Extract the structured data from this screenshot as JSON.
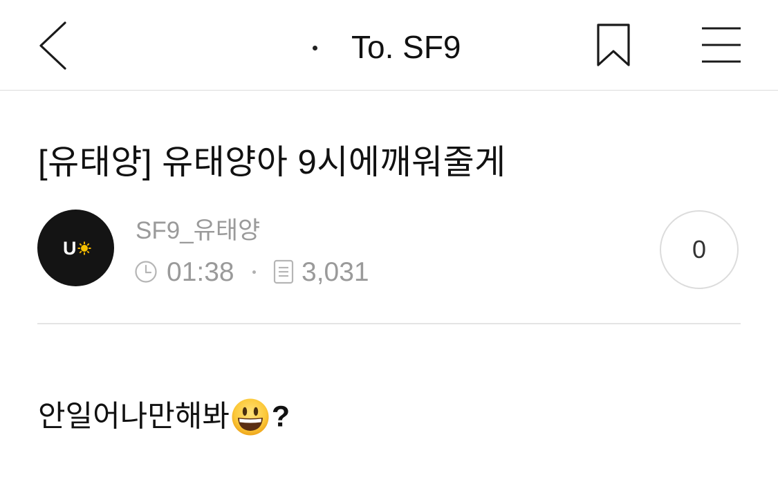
{
  "app_bar": {
    "back_icon": "chevron-left-icon",
    "title": "To. SF9",
    "bookmark_icon": "bookmark-icon",
    "menu_icon": "hamburger-menu-icon"
  },
  "post": {
    "title": "[유태양] 유태양아 9시에깨워줄게",
    "author": {
      "name": "SF9_유태양",
      "avatar_letter": "U"
    },
    "time": "01:38",
    "views": "3,031",
    "like_count": "0",
    "body": {
      "text": "안일어나만해봐",
      "emoji": "grinning-face-emoji",
      "suffix": "?"
    }
  },
  "colors": {
    "text_primary": "#111111",
    "text_secondary": "#9a9a9a",
    "divider": "#e4e4e4",
    "avatar_bg": "#141414"
  }
}
